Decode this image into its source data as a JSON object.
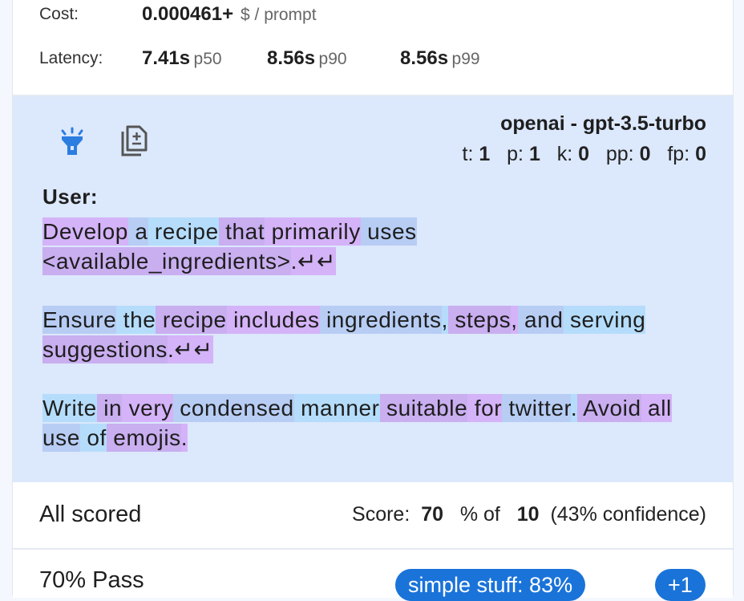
{
  "cost": {
    "label": "Cost:",
    "value": "0.000461+",
    "unit": "$ / prompt"
  },
  "latency": {
    "label": "Latency:",
    "p50_value": "7.41s",
    "p50_label": "p50",
    "p90_value": "8.56s",
    "p90_label": "p90",
    "p99_value": "8.56s",
    "p99_label": "p99"
  },
  "icons": {
    "highlight": "flashlight-icon",
    "copy": "copy-document-icon"
  },
  "model": {
    "name": "openai - gpt-3.5-turbo",
    "t_label": "t:",
    "t_value": "1",
    "p_label": "p:",
    "p_value": "1",
    "k_label": "k:",
    "k_value": "0",
    "pp_label": "pp:",
    "pp_value": "0",
    "fp_label": "fp:",
    "fp_value": "0"
  },
  "prompt": {
    "role": "User:",
    "paragraphs": [
      [
        "Develop",
        " a",
        " recipe",
        " that",
        " primarily",
        " uses",
        " ",
        "<available_ingredients>",
        ".↵↵"
      ],
      [
        "Ensure",
        " the",
        " recipe",
        " includes",
        " ingredients",
        ",",
        " steps",
        ",",
        " and",
        " serving",
        " suggestions",
        ".↵↵"
      ],
      [
        "Write",
        " in",
        " very",
        " condensed",
        " manner",
        " suitable",
        " for",
        " twitter",
        ".",
        " Avoid",
        " all",
        " use",
        " of",
        " emojis",
        "."
      ]
    ]
  },
  "scoring": {
    "title": "All scored",
    "score_label": "Score:",
    "score_value": "70",
    "percent_of": "% of",
    "total": "10",
    "confidence": "(43% confidence)"
  },
  "pass": {
    "title": "70% Pass",
    "tag": "simple stuff: 83%",
    "more": "+1"
  },
  "colors": {
    "panel_bg": "#dce8fc",
    "token_colors": [
      "#d4b3f8",
      "#b7cdf4",
      "#b5ddfb",
      "#c9aef0"
    ],
    "pill": "#1a73d9"
  }
}
